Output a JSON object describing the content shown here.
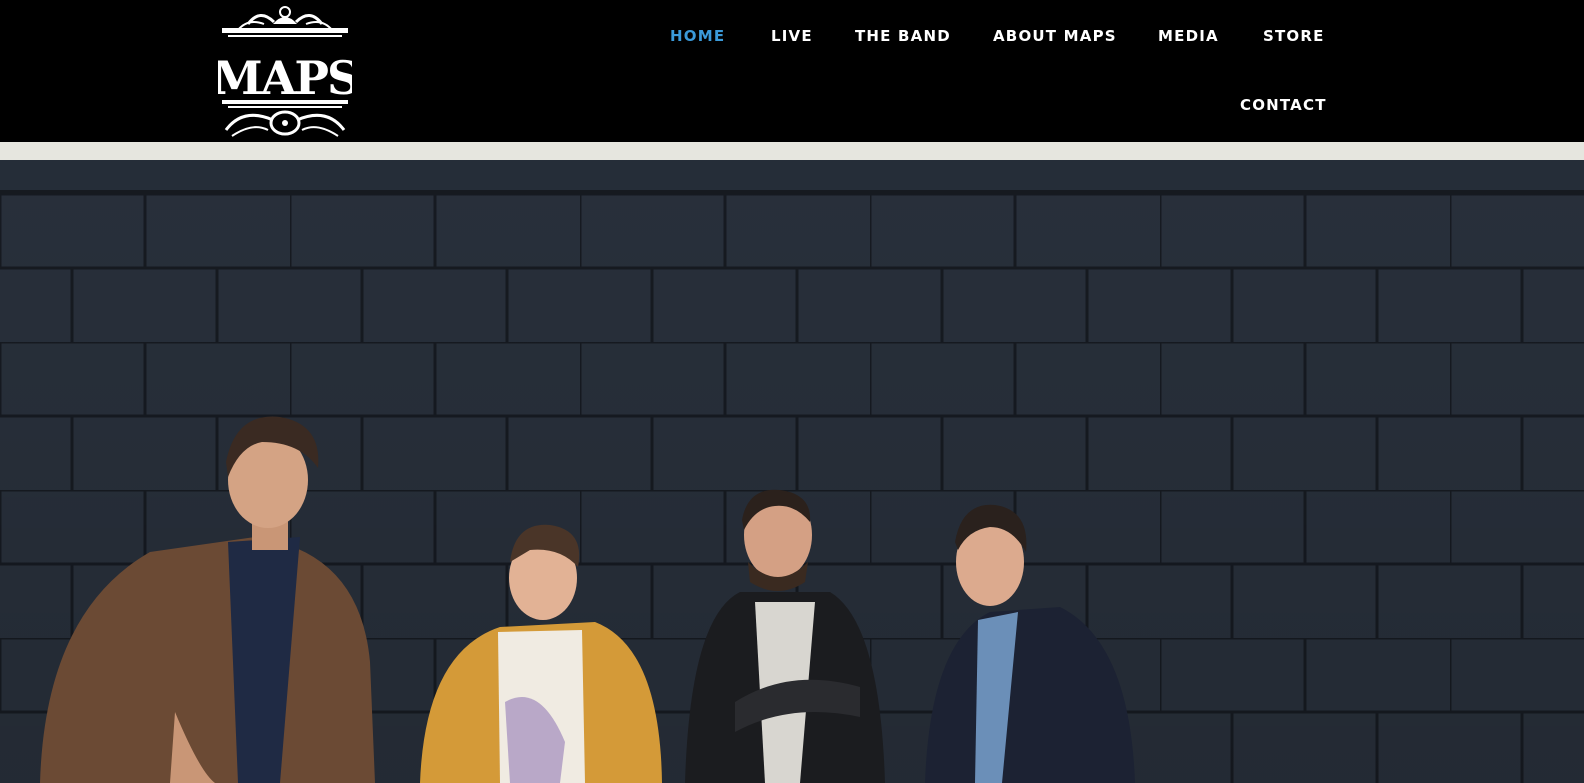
{
  "header": {
    "logo_text": "MAPS",
    "nav": [
      {
        "label": "HOME",
        "active": true
      },
      {
        "label": "LIVE",
        "active": false
      },
      {
        "label": "THE BAND",
        "active": false
      },
      {
        "label": "ABOUT MAPS",
        "active": false
      },
      {
        "label": "MEDIA",
        "active": false
      },
      {
        "label": "STORE",
        "active": false
      },
      {
        "label": "CONTACT",
        "active": false
      }
    ]
  },
  "hero": {
    "image_subject": "band photo",
    "colors": {
      "wall": "#2f3845",
      "mortar": "#1a1f27",
      "trim": "#e6e6df",
      "accent": "#3b9ad9"
    }
  }
}
